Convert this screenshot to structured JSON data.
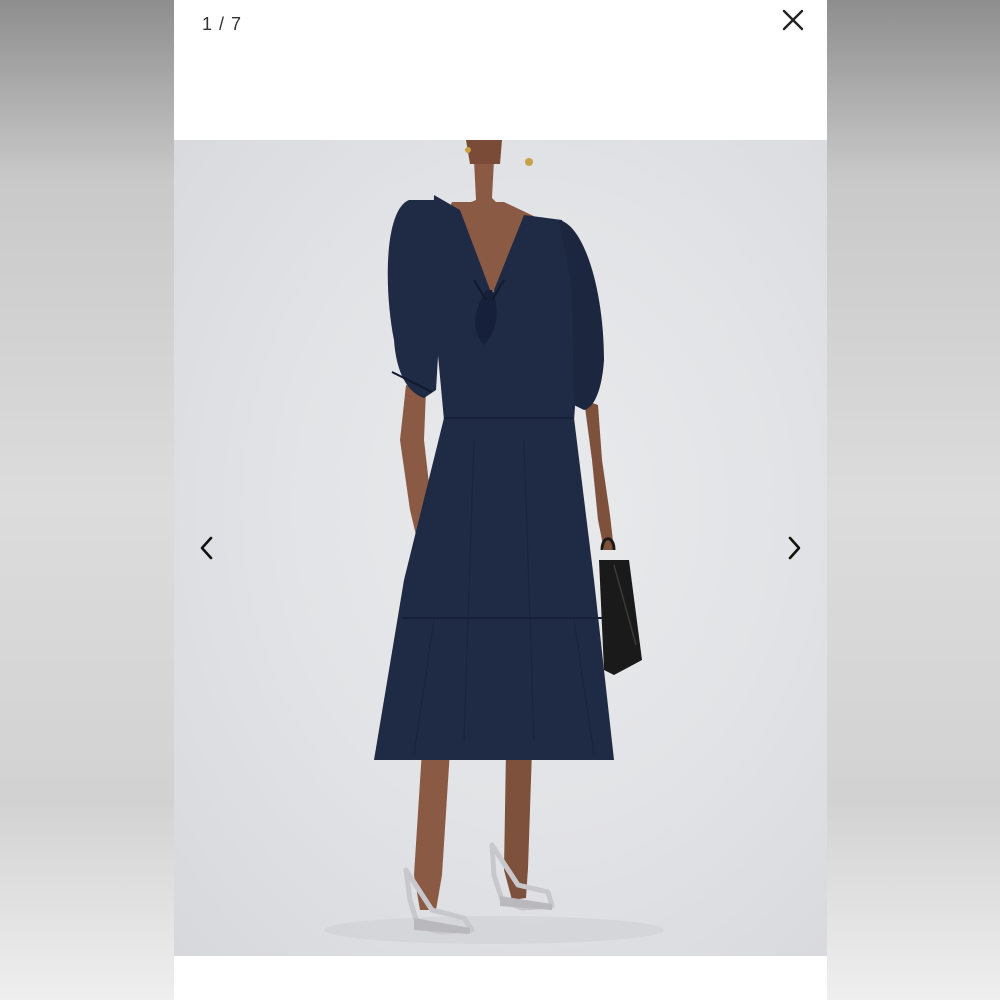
{
  "viewer": {
    "counter": "1 / 7",
    "close_icon": "close-icon",
    "prev_icon": "chevron-left-icon",
    "next_icon": "chevron-right-icon"
  },
  "photo": {
    "subject": "product-photo",
    "colors": {
      "dress": "#1f2a44",
      "background": "#e3e4e7",
      "skin": "#8a5a44",
      "shoes": "#c8c8cc",
      "bag": "#1a1a1a"
    }
  }
}
